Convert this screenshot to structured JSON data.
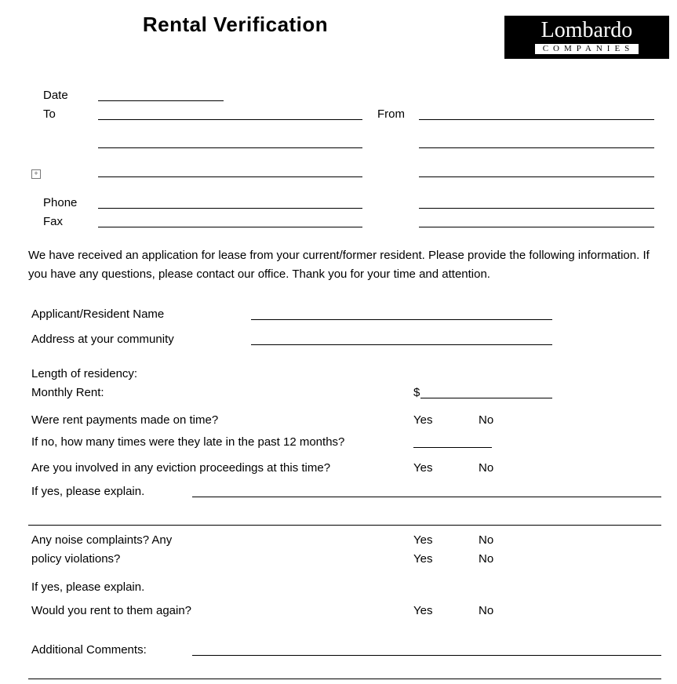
{
  "title": "Rental Verification",
  "logo": {
    "line1": "Lombardo",
    "line2": "COMPANIES"
  },
  "header": {
    "date_label": "Date",
    "to_label": "To",
    "from_label": "From",
    "phone_label": "Phone",
    "fax_label": "Fax"
  },
  "intro": "We have received an application for lease from your current/former resident. Please provide the following information.  If you have any questions, please contact our office.  Thank you for your time and attention.",
  "fields": {
    "applicant_label": "Applicant/Resident Name",
    "address_label": "Address at your community",
    "length_label": "Length of residency:",
    "rent_label": "Monthly Rent:",
    "rent_prefix": "$",
    "ontime_label": "Were rent payments made on time?",
    "late_label": "If no, how many times were they late in the past 12 months?",
    "eviction_label": "Are you involved in any eviction proceedings at this time?",
    "explain1_label": "If yes, please explain.",
    "noise_label": "Any noise complaints? Any",
    "policy_label": "policy violations?",
    "explain2_label": "If yes, please explain.",
    "rentagain_label": "Would you rent to them again?",
    "comments_label": "Additional Comments:"
  },
  "options": {
    "yes": "Yes",
    "no": "No"
  }
}
